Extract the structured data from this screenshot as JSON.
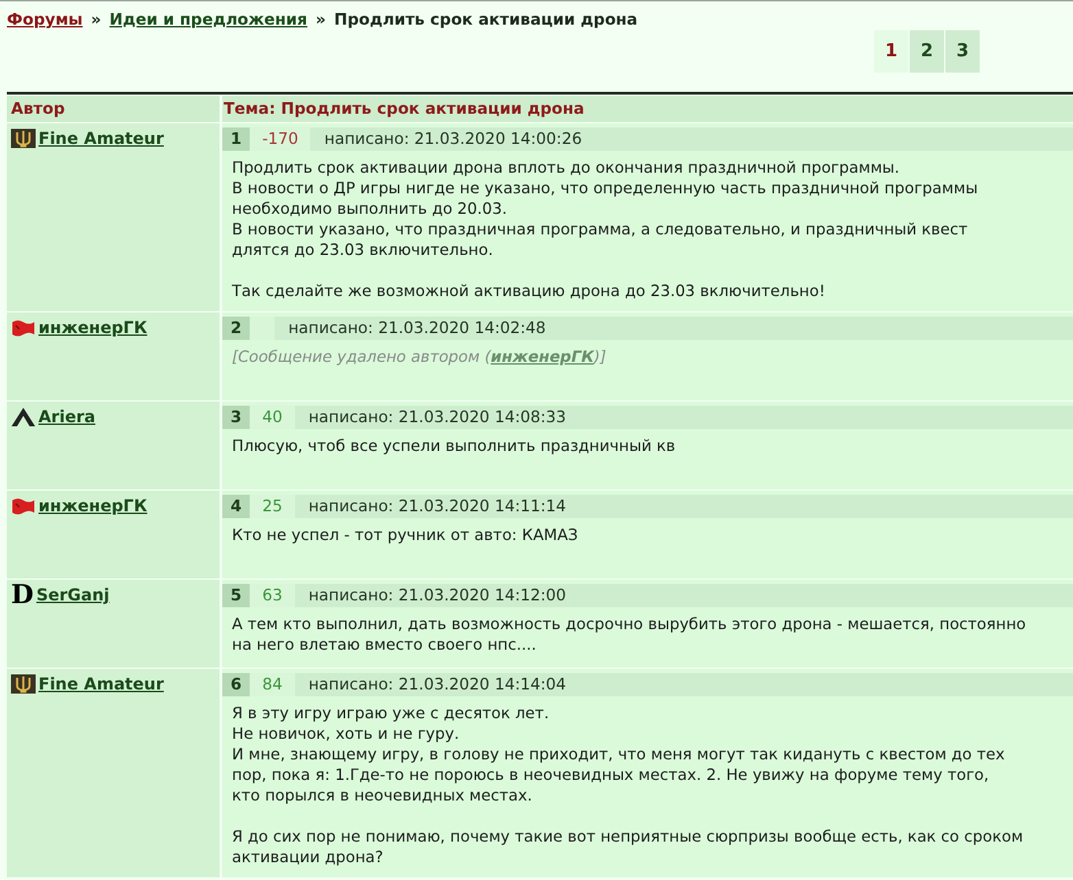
{
  "breadcrumb": [
    {
      "kind": "link",
      "label": "Форумы",
      "visited": true
    },
    {
      "kind": "separator",
      "label": "»"
    },
    {
      "kind": "link",
      "label": "Идеи и предложения",
      "visited": false
    },
    {
      "kind": "separator",
      "label": "»"
    },
    {
      "kind": "current",
      "label": "Продлить срок активации дрона"
    }
  ],
  "pager": [
    {
      "label": "1",
      "selected": true
    },
    {
      "label": "2",
      "selected": false
    },
    {
      "label": "3",
      "selected": false
    }
  ],
  "table": {
    "columns": [
      "Автор",
      "Тема: Продлить срок активации дрона"
    ],
    "posts": [
      {
        "author": {
          "name": "Fine Amateur",
          "emblem": {
            "kind": "trident"
          }
        },
        "number": "1",
        "rating": {
          "value": "-170",
          "color": "#a83636"
        },
        "posted": "написано: 21.03.2020 14:00:26",
        "kind": "message",
        "paragraphs": [
          "Продлить срок активации дрона вплоть до окончания праздничной программы.\nВ новости о ДР игры нигде не указано, что определенную часть праздничной программы\nнеобходимо выполнить до 20.03.\nВ новости указано, что праздничная программа, а следовательно, и праздничный квест\nдлятся до 23.03 включительно.",
          "Так сделайте же возможной активацию дрона до 23.03 включительно!"
        ]
      },
      {
        "author": {
          "name": "инженерГК",
          "emblem": {
            "kind": "flag"
          }
        },
        "number": "2",
        "posted": "написано: 21.03.2020 14:02:48",
        "kind": "deleted",
        "notice": {
          "before": "[Сообщение удалено автором (",
          "author": "инженерГК",
          "after": ")]"
        }
      },
      {
        "author": {
          "name": "Ariera",
          "emblem": {
            "kind": "triangle"
          }
        },
        "number": "3",
        "rating": {
          "value": "40",
          "color": "#3a963a"
        },
        "posted": "написано: 21.03.2020 14:08:33",
        "kind": "message",
        "paragraphs": [
          "Плюсую, чтоб все успели выполнить праздничный кв"
        ]
      },
      {
        "author": {
          "name": "инженерГК",
          "emblem": {
            "kind": "flag"
          }
        },
        "number": "4",
        "rating": {
          "value": "25",
          "color": "#3a963a"
        },
        "posted": "написано: 21.03.2020 14:11:14",
        "kind": "message",
        "paragraphs": [
          "Кто не успел - тот ручник от авто: КАМАЗ"
        ]
      },
      {
        "author": {
          "name": "SerGanj",
          "emblem": {
            "kind": "letter",
            "text": "D"
          }
        },
        "number": "5",
        "rating": {
          "value": "63",
          "color": "#3a963a"
        },
        "posted": "написано: 21.03.2020 14:12:00",
        "kind": "message",
        "paragraphs": [
          "А тем кто выполнил, дать возможность досрочно вырубить этого дрона - мешается, постоянно\nна него влетаю вместо своего нпс...."
        ]
      },
      {
        "author": {
          "name": "Fine Amateur",
          "emblem": {
            "kind": "trident"
          }
        },
        "number": "6",
        "rating": {
          "value": "84",
          "color": "#3a963a"
        },
        "posted": "написано: 21.03.2020 14:14:04",
        "kind": "message",
        "paragraphs": [
          "Я в эту игру играю уже с десяток лет.\nНе новичок, хоть и не гуру.\nИ мне, знающему игру, в голову не приходит, что меня могут так кидануть с квестом до тех\nпор, пока я: 1.Где-то не пороюсь в неочевидных местах. 2. Не увижу на форуме тему того,\nкто порылся в неочевидных местах.",
          "Я до сих пор не понимаю, почему такие вот неприятные сюрпризы вообще есть, как со сроком\nактивации дрона?"
        ]
      }
    ]
  }
}
